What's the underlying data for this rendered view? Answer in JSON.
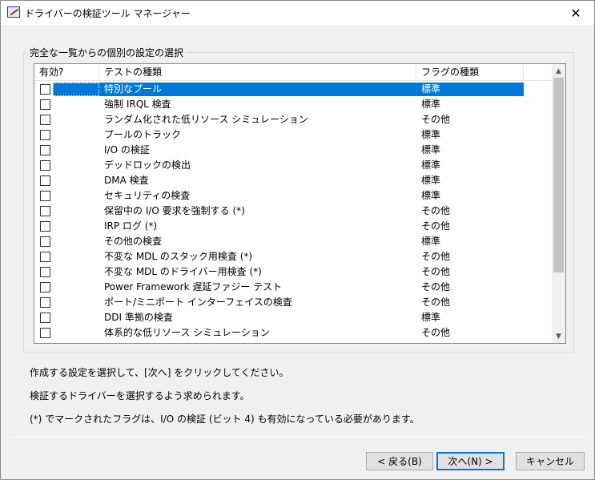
{
  "window": {
    "title": "ドライバーの検証ツール マネージャー",
    "close_glyph": "✕"
  },
  "group": {
    "label": "完全な一覧からの個別の設定の選択"
  },
  "columns": {
    "enabled": "有効?",
    "test_type": "テストの種類",
    "flag_type": "フラグの種類"
  },
  "rows": [
    {
      "name": "特別なプール",
      "flag": "標準",
      "selected": true
    },
    {
      "name": "強制 IRQL 検査",
      "flag": "標準"
    },
    {
      "name": "ランダム化された低リソース シミュレーション",
      "flag": "その他"
    },
    {
      "name": "プールのトラック",
      "flag": "標準"
    },
    {
      "name": "I/O の検証",
      "flag": "標準"
    },
    {
      "name": "デッドロックの検出",
      "flag": "標準"
    },
    {
      "name": "DMA 検査",
      "flag": "標準"
    },
    {
      "name": "セキュリティの検査",
      "flag": "標準"
    },
    {
      "name": "保留中の I/O 要求を強制する (*)",
      "flag": "その他"
    },
    {
      "name": "IRP ログ (*)",
      "flag": "その他"
    },
    {
      "name": "その他の検査",
      "flag": "標準"
    },
    {
      "name": "不変な MDL のスタック用検査 (*)",
      "flag": "その他"
    },
    {
      "name": "不変な MDL のドライバー用検査 (*)",
      "flag": "その他"
    },
    {
      "name": "Power Framework 遅延ファジー テスト",
      "flag": "その他"
    },
    {
      "name": "ポート/ミニポート インターフェイスの検査",
      "flag": "その他"
    },
    {
      "name": "DDI 準拠の検査",
      "flag": "標準"
    },
    {
      "name": "体系的な低リソース シミュレーション",
      "flag": "その他"
    }
  ],
  "info": {
    "line1": "作成する設定を選択して、[次へ] をクリックしてください。",
    "line2": "検証するドライバーを選択するよう求められます。",
    "line3": "(*) でマークされたフラグは、I/O の検証 (ビット 4) も有効になっている必要があります。"
  },
  "buttons": {
    "back": "< 戻る(B)",
    "next": "次へ(N) >",
    "cancel": "キャンセル"
  },
  "colors": {
    "selection": "#0078d7",
    "window_bg": "#f0f0f0"
  }
}
